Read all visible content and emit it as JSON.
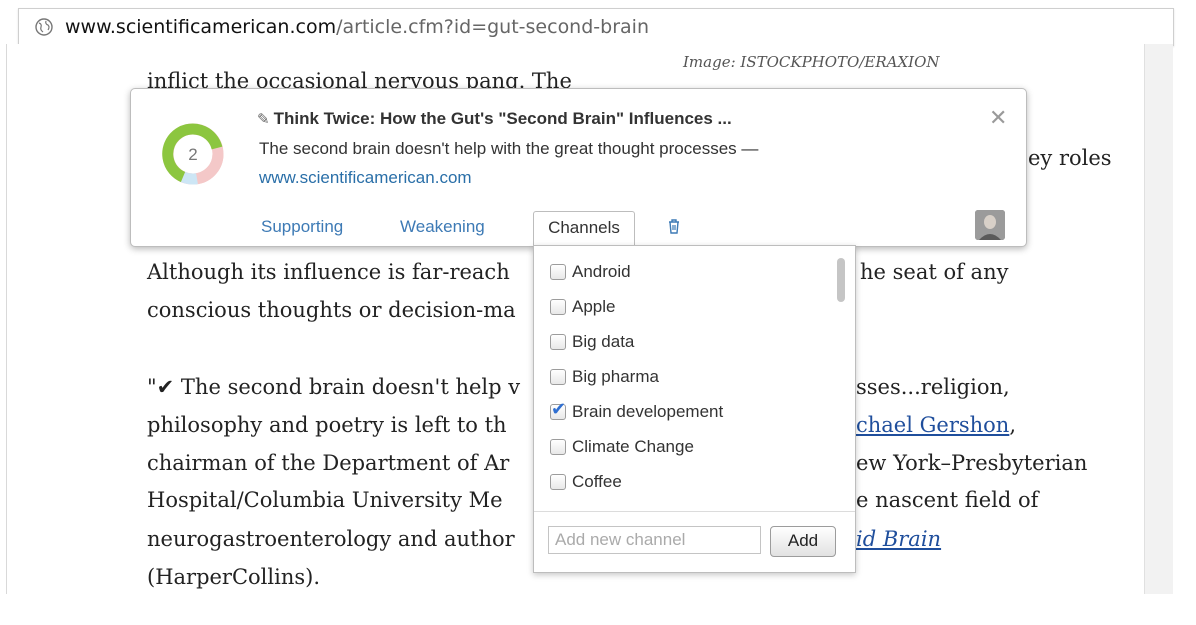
{
  "browser": {
    "url_domain": "www.scientificamerican.com",
    "url_path": "/article.cfm?id=gut-second-brain"
  },
  "article": {
    "image_credit": "Image: ISTOCKPHOTO/ERAXION",
    "lines": [
      "inflict the occasional nervous pang. The",
      "ey roles",
      "Although its influence is far-reach",
      "he seat of any",
      "conscious thoughts or decision-ma",
      "\"✔ The second brain doesn't help v",
      "sses...religion,",
      "philosophy and poetry is left to th",
      "chael Gershon",
      ",",
      "chairman of the Department of Ar",
      "ew York–Presbyterian",
      "Hospital/Columbia University Me",
      "e nascent field of",
      "neurogastroenterology and author",
      "id Brain",
      "(HarperCollins)."
    ]
  },
  "card": {
    "count": "2",
    "title": "Think Twice: How the Gut's \"Second Brain\" Influences ...",
    "excerpt": "The second brain doesn't help with the great thought processes —",
    "domain": "www.scientificamerican.com",
    "close_icon": "✕",
    "tabs": {
      "supporting": "Supporting",
      "weakening": "Weakening",
      "channels": "Channels"
    },
    "donut_colors": {
      "green": "#8cc63f",
      "pink": "#f4c8c8",
      "blue": "#cde6f5"
    }
  },
  "channels": {
    "items": [
      {
        "label": "Android",
        "checked": false
      },
      {
        "label": "Apple",
        "checked": false
      },
      {
        "label": "Big data",
        "checked": false
      },
      {
        "label": "Big pharma",
        "checked": false
      },
      {
        "label": "Brain developement",
        "checked": true
      },
      {
        "label": "Climate Change",
        "checked": false
      },
      {
        "label": "Coffee",
        "checked": false
      }
    ],
    "new_placeholder": "Add new channel",
    "add_label": "Add"
  }
}
